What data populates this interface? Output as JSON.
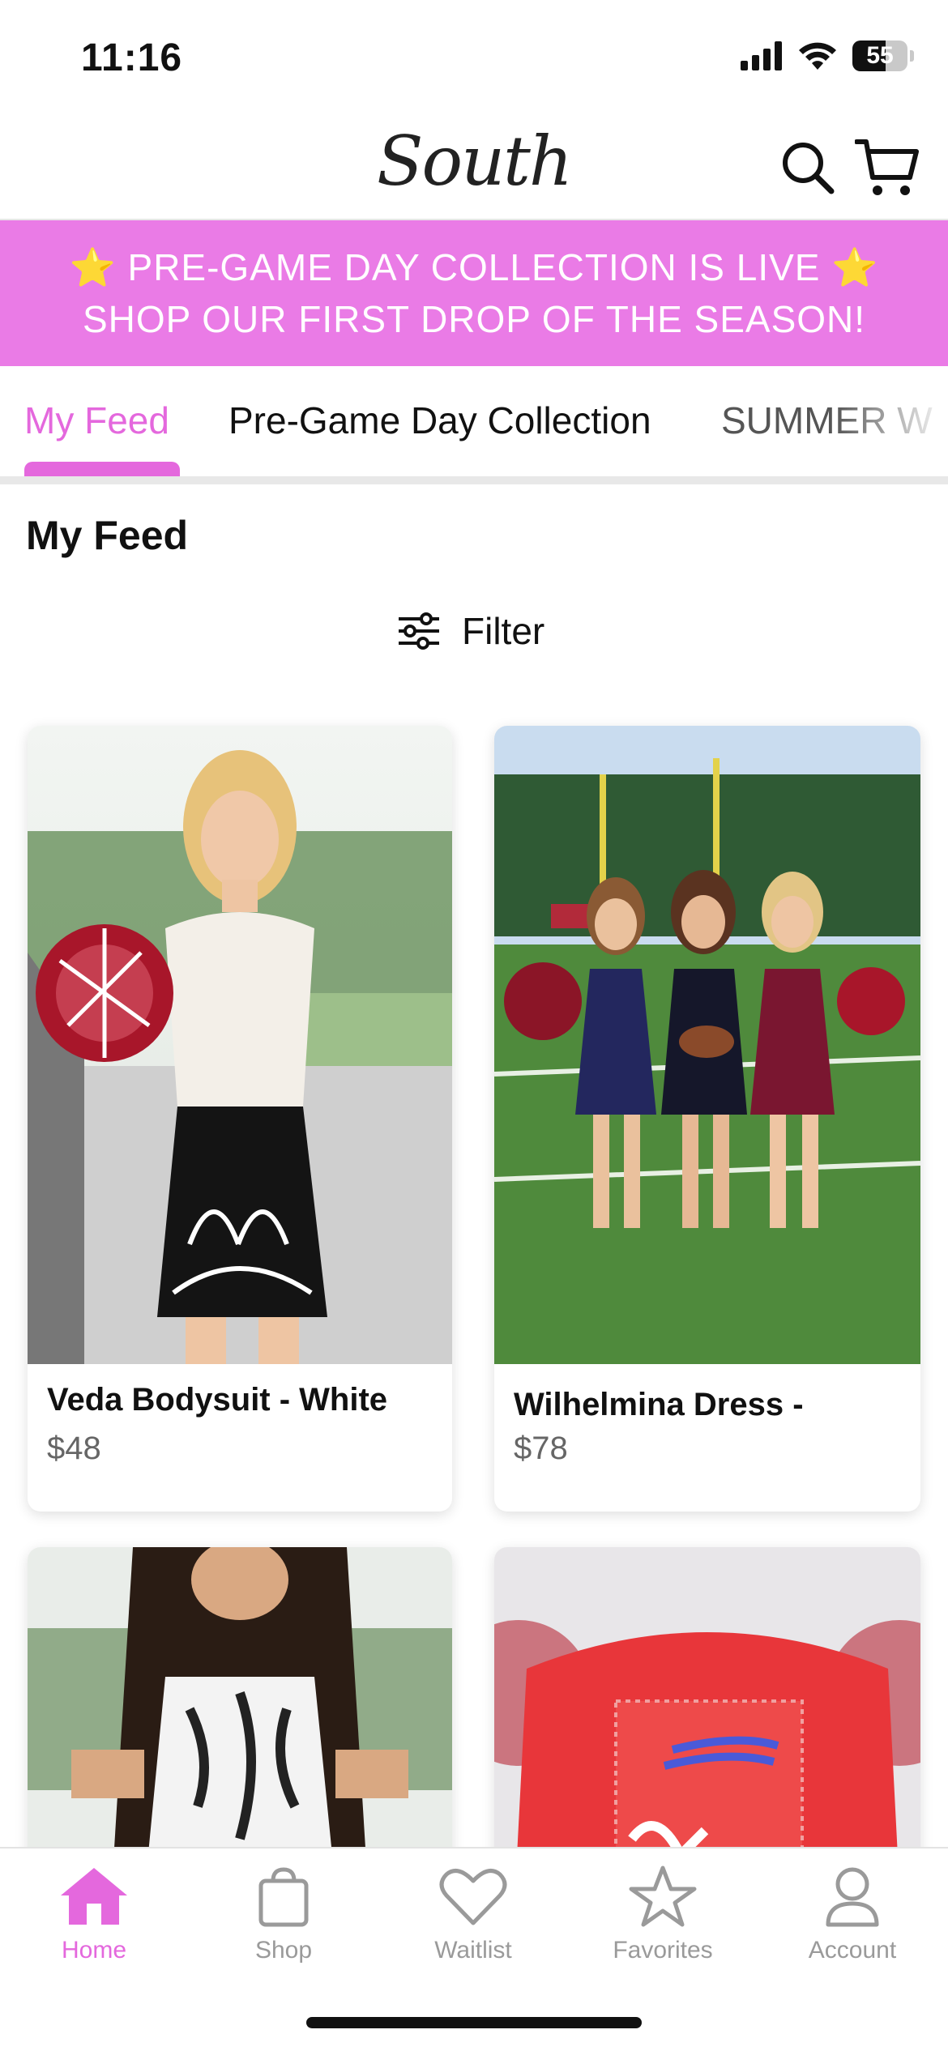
{
  "status_bar": {
    "time": "11:16",
    "battery": "55"
  },
  "header": {
    "logo": "South"
  },
  "promo": {
    "line1": "PRE-GAME DAY COLLECTION IS LIVE",
    "line2": "SHOP OUR FIRST DROP OF THE SEASON!",
    "star": "⭐"
  },
  "tabs": [
    {
      "label": "My Feed"
    },
    {
      "label": "Pre-Game Day Collection"
    },
    {
      "label": "SUMMER W"
    }
  ],
  "feed": {
    "title": "My Feed",
    "filter_label": "Filter"
  },
  "products": [
    {
      "name": "Veda Bodysuit - White",
      "price": "$48"
    },
    {
      "name": "Wilhelmina Dress -",
      "price": "$78"
    }
  ],
  "bottom_nav": [
    {
      "label": "Home",
      "icon": "home-icon",
      "active": true
    },
    {
      "label": "Shop",
      "icon": "bag-icon"
    },
    {
      "label": "Waitlist",
      "icon": "heart-icon"
    },
    {
      "label": "Favorites",
      "icon": "star-icon"
    },
    {
      "label": "Account",
      "icon": "person-icon"
    }
  ],
  "colors": {
    "accent": "#e468dd",
    "promo_bg": "#ea7be6"
  }
}
